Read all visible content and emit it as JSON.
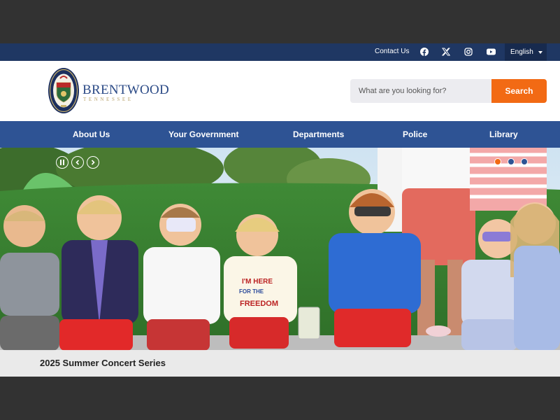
{
  "utility_bar": {
    "contact_label": "Contact Us",
    "social_icons": [
      "facebook-icon",
      "x-icon",
      "instagram-icon",
      "youtube-icon"
    ],
    "language": "English"
  },
  "header": {
    "brand_name": "BRENTWOOD",
    "brand_sub": "TENNESSEE",
    "search_placeholder": "What are you looking for?",
    "search_button": "Search"
  },
  "nav": {
    "items": [
      "About Us",
      "Your Government",
      "Departments",
      "Police",
      "Library"
    ]
  },
  "hero": {
    "caption": "2025 Summer Concert Series",
    "slide_count": 3,
    "active_slide": 1,
    "controls": [
      "pause-icon",
      "chevron-left-icon",
      "chevron-right-icon"
    ],
    "shirt_text": "I'M HERE FOR THE FREEDOM"
  },
  "colors": {
    "utility_bg": "#1f3763",
    "nav_bg": "#2e5394",
    "accent": "#f26a14",
    "brand_blue": "#2b4a86",
    "brand_gold": "#b7a26a"
  }
}
